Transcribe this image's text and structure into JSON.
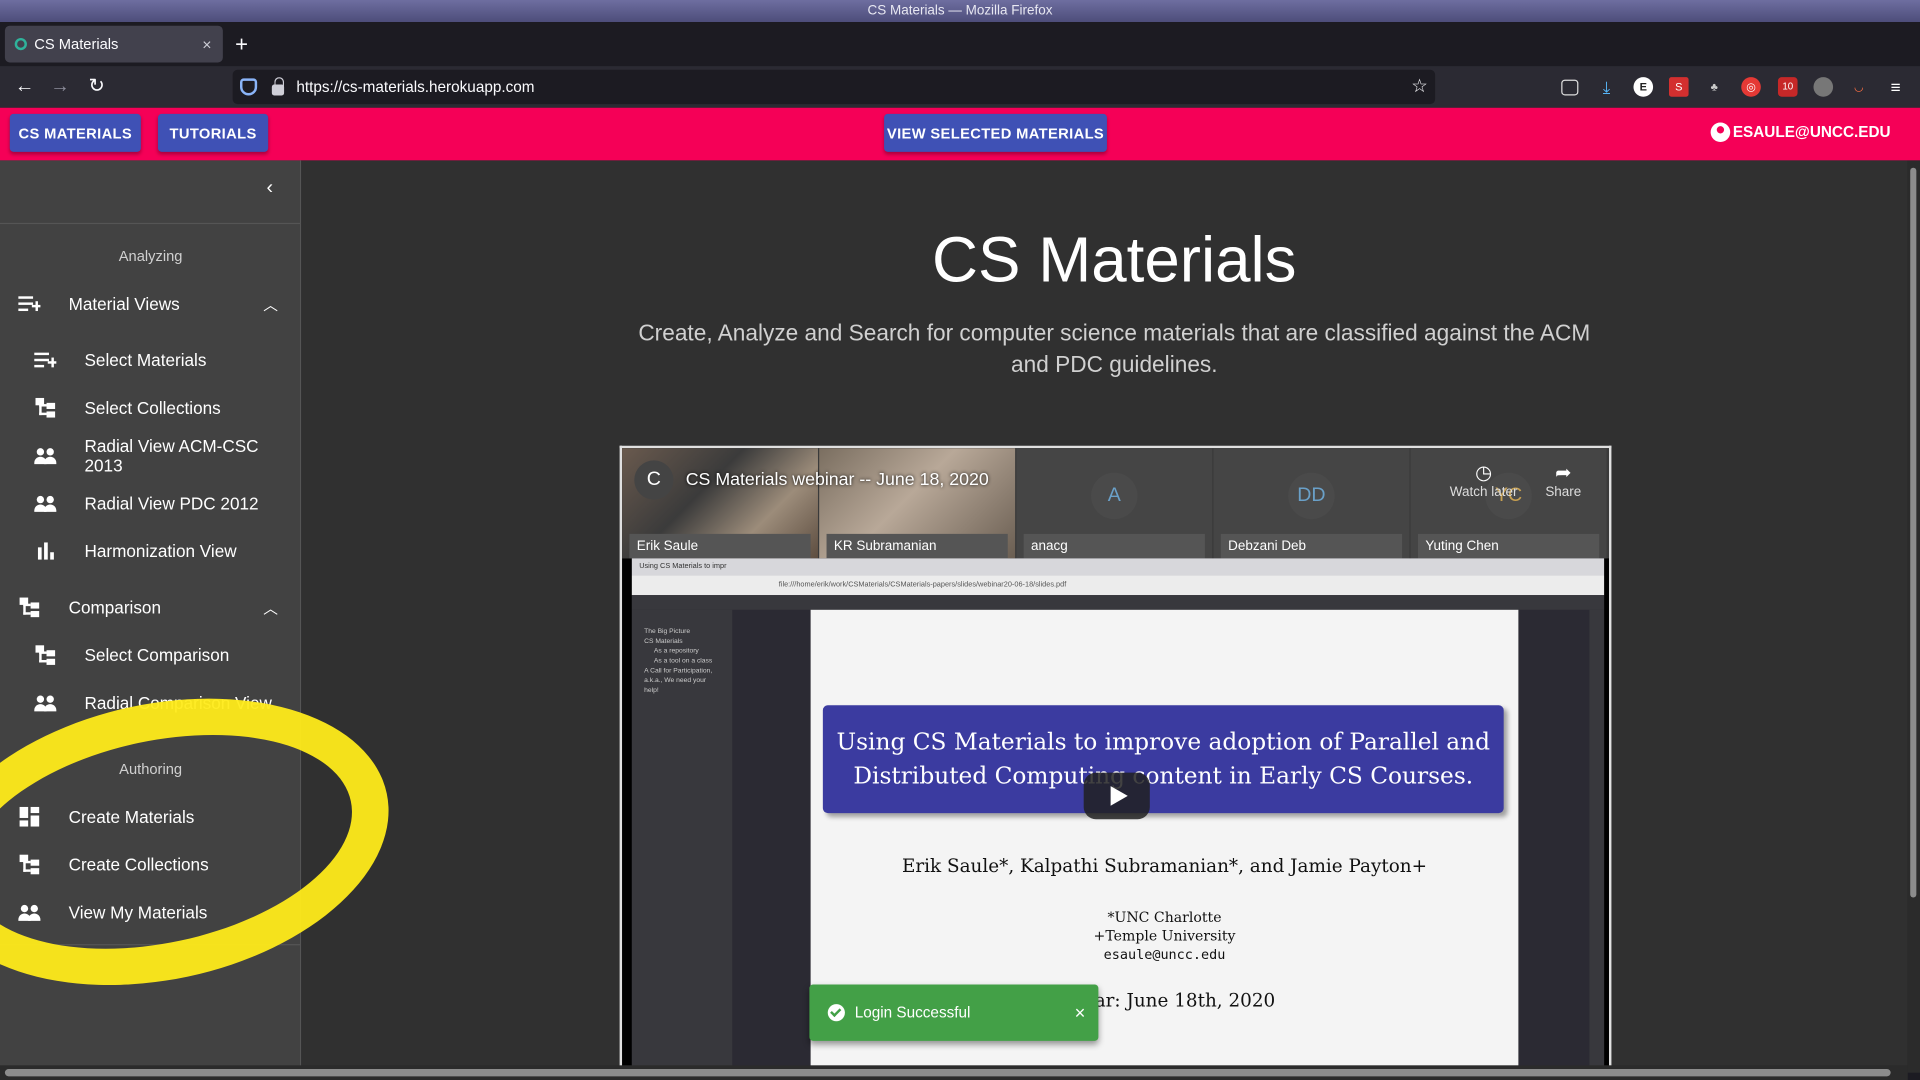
{
  "window": {
    "title": "CS Materials — Mozilla Firefox"
  },
  "browser": {
    "tab_title": "CS Materials",
    "tab_close": "×",
    "new_tab": "+",
    "url_host": "https://cs-materials.herokuapp.com",
    "extension_badge": "10"
  },
  "appbar": {
    "cs_materials": "CS MATERIALS",
    "tutorials": "TUTORIALS",
    "view_selected": "VIEW SELECTED MATERIALS",
    "user": "ESAULE@UNCC.EDU"
  },
  "sidebar": {
    "collapse_icon": "‹",
    "analyzing_header": "Analyzing",
    "material_views": "Material Views",
    "items_views": [
      {
        "label": "Select Materials",
        "icon": "playlist-add-icon"
      },
      {
        "label": "Select Collections",
        "icon": "tree-icon"
      },
      {
        "label": "Radial View ACM-CSC 2013",
        "icon": "people-icon"
      },
      {
        "label": "Radial View PDC 2012",
        "icon": "people-icon"
      },
      {
        "label": "Harmonization View",
        "icon": "bar-chart-icon"
      }
    ],
    "comparison": "Comparison",
    "items_comparison": [
      {
        "label": "Select Comparison",
        "icon": "tree-icon"
      },
      {
        "label": "Radial Comparison View",
        "icon": "people-icon"
      }
    ],
    "authoring_header": "Authoring",
    "items_authoring": [
      {
        "label": "Create Materials",
        "icon": "dashboard-icon"
      },
      {
        "label": "Create Collections",
        "icon": "tree-icon"
      },
      {
        "label": "View My Materials",
        "icon": "people-icon"
      }
    ]
  },
  "main": {
    "title": "CS Materials",
    "subtitle": "Create, Analyze and Search for computer science materials that are classified against the ACM and PDC guidelines."
  },
  "video": {
    "channel_initial": "C",
    "title": "CS Materials webinar -- June 18, 2020",
    "watch_later": "Watch later",
    "share": "Share",
    "participants": [
      {
        "name": "Erik Saule",
        "initial": ""
      },
      {
        "name": "KR Subramanian",
        "initial": ""
      },
      {
        "name": "anacg",
        "initial": "A"
      },
      {
        "name": "Debzani Deb",
        "initial": "DD"
      },
      {
        "name": "Yuting Chen",
        "initial": "YC"
      }
    ],
    "inner_tab": "Using CS Materials to impr",
    "inner_url": "file:///home/erik/work/CSMaterials/CSMaterials-papers/slides/webinar20-06-18/slides.pdf",
    "inner_sidebar": [
      "The Big Picture",
      "CS Materials",
      "As a repository",
      "As a tool on a class",
      "A Call for Participation, a.k.a., We need your help!"
    ],
    "slide_title_line1": "Using CS Materials to improve adoption of Parallel and",
    "slide_title_line2": "Distributed Computing content in Early CS Courses.",
    "slide_authors": "Erik Saule*, Kalpathi Subramanian*, and Jamie Payton+",
    "slide_affil1": "*UNC Charlotte",
    "slide_affil2": "+Temple University",
    "slide_email": "esaule@uncc.edu",
    "slide_date": "ar:  June 18th, 2020"
  },
  "snackbar": {
    "message": "Login Successful",
    "close": "×"
  }
}
